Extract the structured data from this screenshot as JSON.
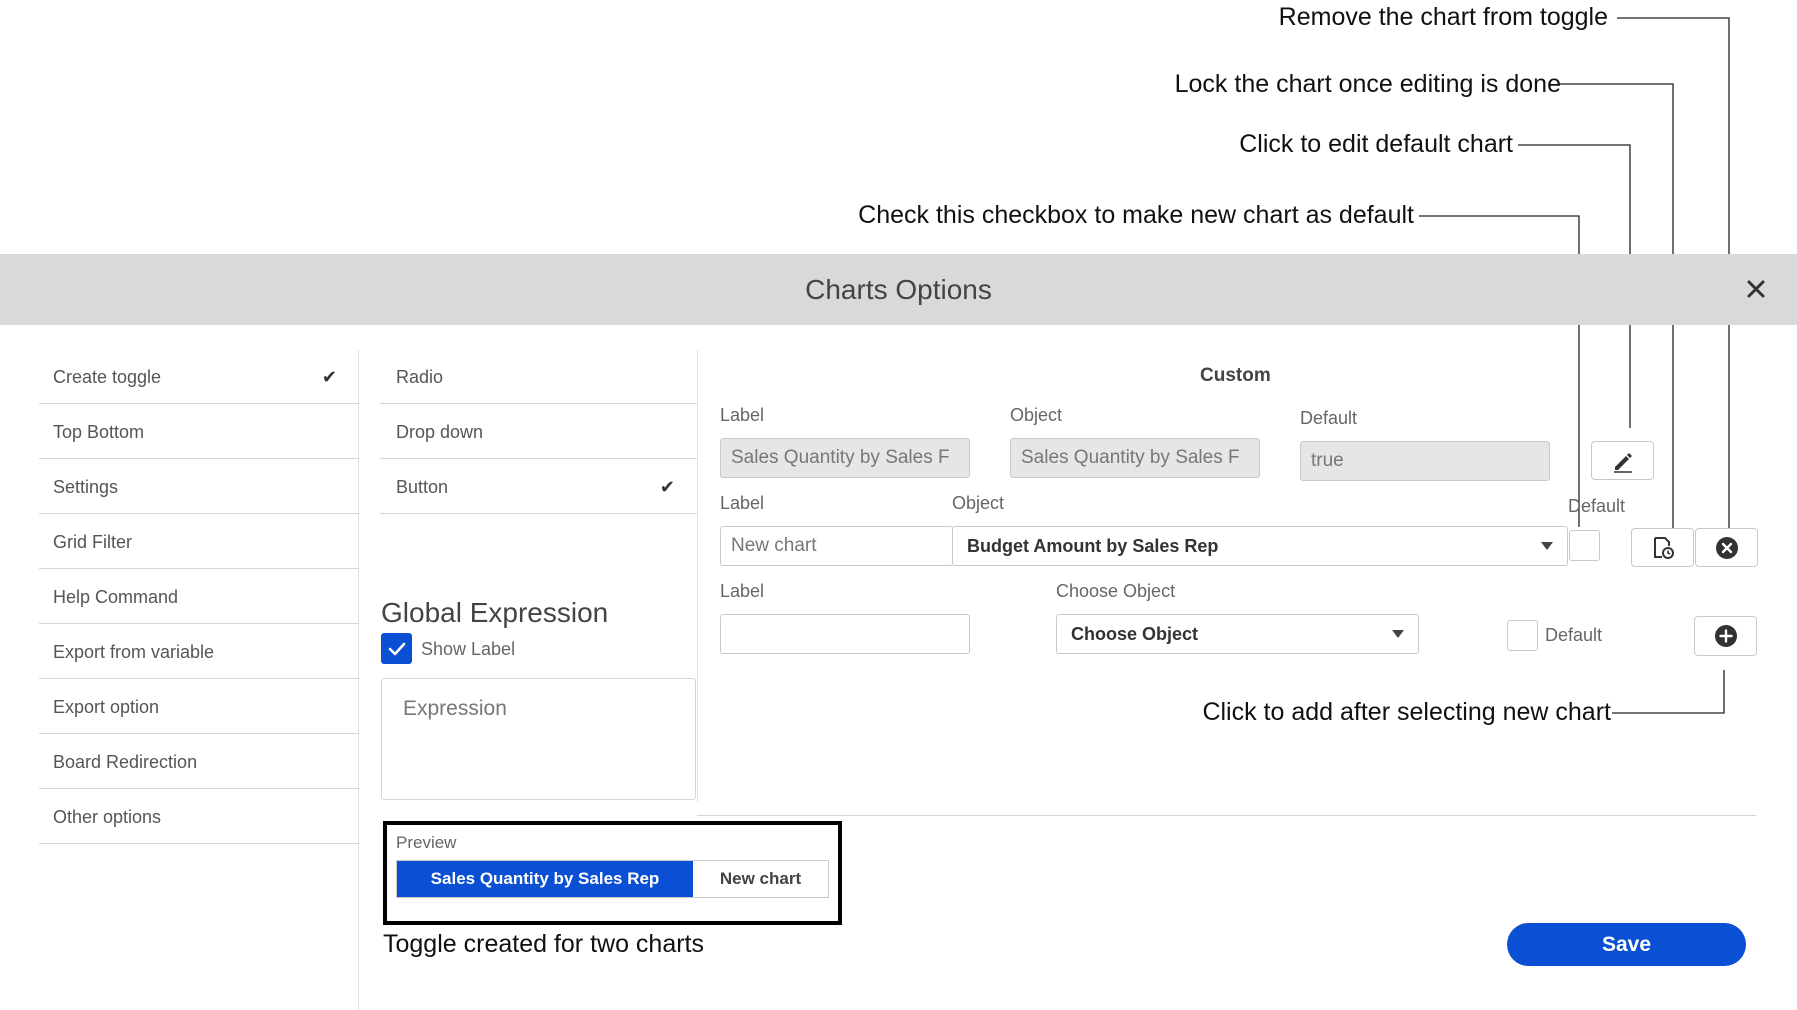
{
  "annotations": {
    "remove_chart": "Remove the chart from toggle",
    "lock_chart": "Lock the chart once editing is done",
    "edit_default": "Click to edit default chart",
    "check_default": "Check this checkbox to make new chart as default",
    "add_after_select": "Click to add after selecting new chart",
    "toggle_created": "Toggle created for two charts"
  },
  "dialog": {
    "title": "Charts Options",
    "close_icon": "close-icon"
  },
  "sidebar": {
    "items": [
      {
        "label": "Create toggle",
        "checked": true
      },
      {
        "label": "Top Bottom"
      },
      {
        "label": "Settings"
      },
      {
        "label": "Grid Filter"
      },
      {
        "label": "Help Command"
      },
      {
        "label": "Export from variable"
      },
      {
        "label": "Export option"
      },
      {
        "label": "Board Redirection"
      },
      {
        "label": "Other options"
      }
    ]
  },
  "toggle_types": {
    "items": [
      {
        "label": "Radio"
      },
      {
        "label": "Drop down"
      },
      {
        "label": "Button",
        "checked": true
      }
    ],
    "check_glyph": "✔"
  },
  "global_expression": {
    "heading": "Global Expression",
    "show_label": "Show Label",
    "show_label_checked": true,
    "expression_placeholder": "Expression"
  },
  "custom": {
    "heading": "Custom",
    "row1": {
      "label_header": "Label",
      "object_header": "Object",
      "default_header": "Default",
      "label_value": "Sales Quantity by Sales F",
      "object_value": "Sales Quantity by Sales F",
      "default_value": "true",
      "edit_icon": "pencil-icon"
    },
    "row2": {
      "label_header": "Label",
      "object_header": "Object",
      "default_header": "Default",
      "label_value": "New chart",
      "object_value": "Budget Amount by Sales Rep",
      "lock_icon": "lock-clock-icon",
      "remove_icon": "remove-circle-icon"
    },
    "row3": {
      "label_header": "Label",
      "object_header": "Choose Object",
      "label_value": "",
      "object_value": "Choose Object",
      "default_label": "Default",
      "add_icon": "add-circle-icon"
    }
  },
  "preview": {
    "label": "Preview",
    "buttons": [
      "Sales Quantity by Sales Rep",
      "New chart"
    ]
  },
  "footer": {
    "save_label": "Save"
  },
  "colors": {
    "primary": "#0a4fd4",
    "header_bg": "#d9d9d9",
    "disabled_bg": "#e6e6e6"
  }
}
